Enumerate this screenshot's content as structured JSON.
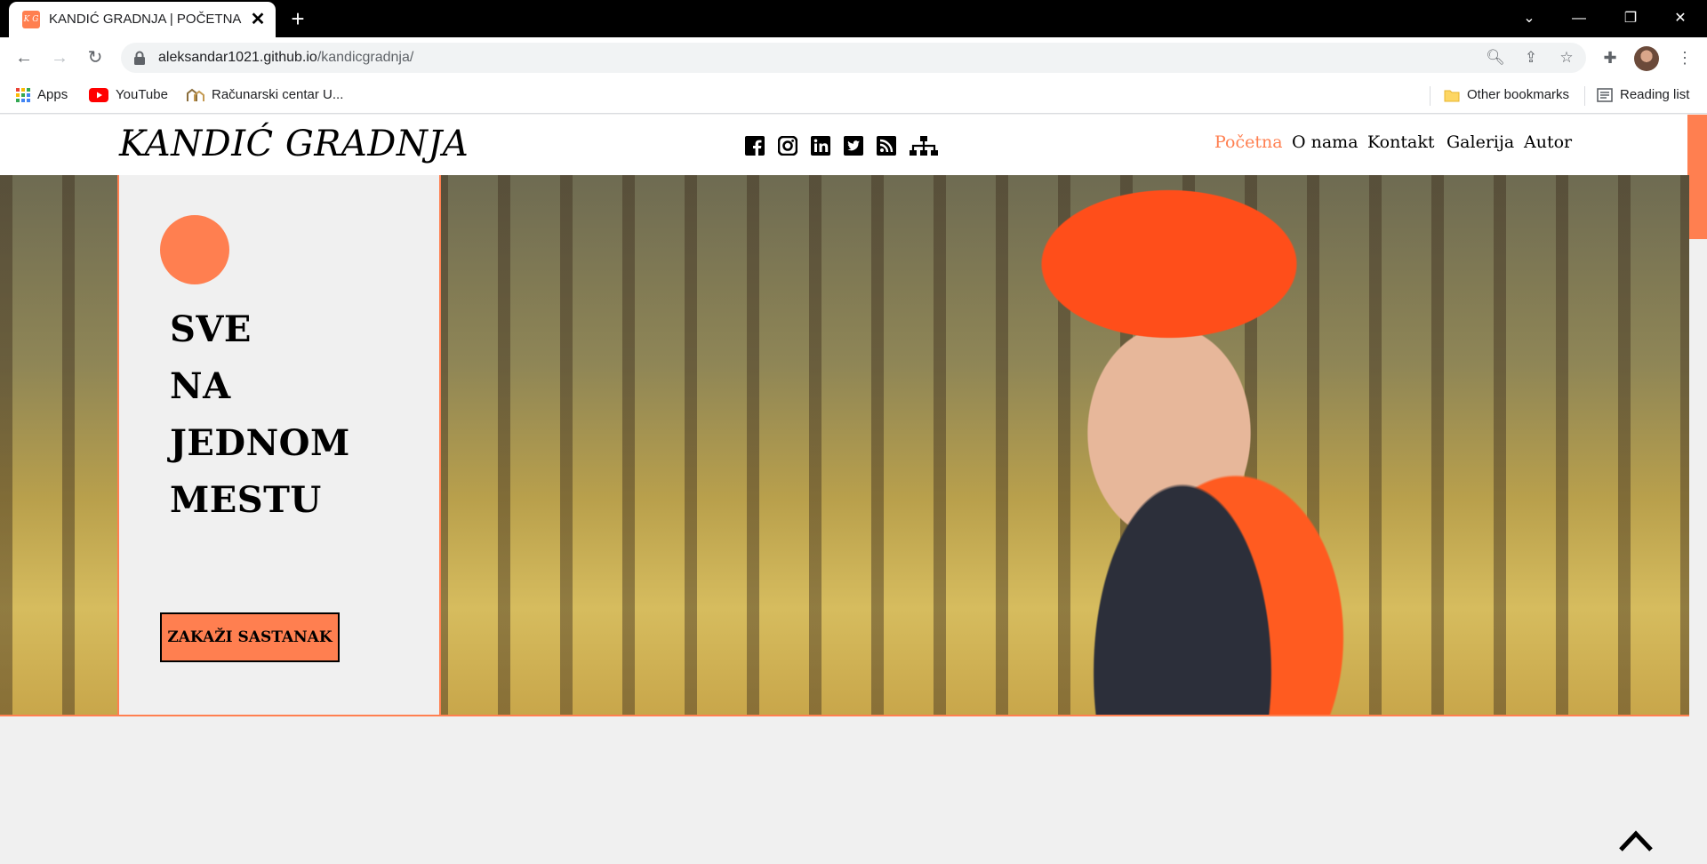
{
  "browser": {
    "tab_title": "KANDIĆ GRADNJA | POČETNA",
    "favicon_text": "K G",
    "url_host": "aleksandar1021.github.io",
    "url_path": "/kandicgradnja/",
    "bookmarks": [
      "Apps",
      "YouTube",
      "Računarski centar U..."
    ],
    "other_bookmarks": "Other bookmarks",
    "reading_list": "Reading list"
  },
  "site": {
    "logo": "KANDIĆ GRADNJA",
    "social_icons": [
      "facebook-icon",
      "instagram-icon",
      "linkedin-icon",
      "twitter-icon",
      "rss-icon",
      "sitemap-icon"
    ],
    "nav": [
      {
        "label": "Početna",
        "active": true
      },
      {
        "label": "O nama",
        "active": false
      },
      {
        "label": "Kontakt",
        "active": false
      },
      {
        "label": "Galerija",
        "active": false
      },
      {
        "label": "Autor",
        "active": false
      }
    ],
    "hero": {
      "lines": [
        "SVE",
        "NA",
        "JEDNOM",
        "MESTU"
      ],
      "button": "ZAKAŽI SASTANAK"
    },
    "accent_color": "#ff7f50"
  }
}
